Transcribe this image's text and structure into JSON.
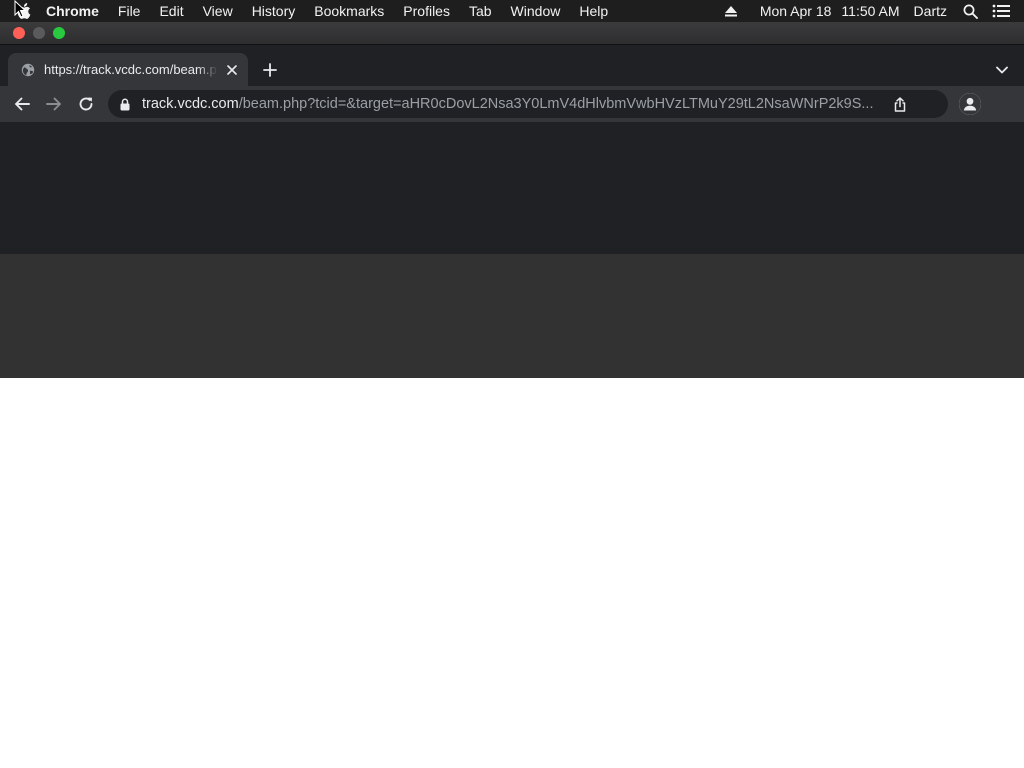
{
  "menubar": {
    "app_name": "Chrome",
    "items": [
      "File",
      "Edit",
      "View",
      "History",
      "Bookmarks",
      "Profiles",
      "Tab",
      "Window",
      "Help"
    ],
    "date": "Mon Apr 18",
    "time": "11:50 AM",
    "user": "Dartz",
    "icons": [
      "apple-icon",
      "eject-icon",
      "spotlight-search-icon",
      "control-center-icon"
    ]
  },
  "window": {
    "controls": [
      "close",
      "minimize",
      "zoom"
    ]
  },
  "tabs": [
    {
      "title": "https://track.vcdc.com/beam.php",
      "active": true,
      "favicon": "globe-icon"
    }
  ],
  "toolbar": {
    "url_host": "track.vcdc.com",
    "url_path": "/beam.php?tcid=&target=aHR0cDovL2Nsa3Y0LmV4dHlvbmVwbHVzLTMuY29tL2NsaWNrP2k9S..."
  },
  "colors": {
    "menubar_bg": "#1e1e1f",
    "tabstrip_bg": "#202124",
    "toolbar_bg": "#35363a",
    "page_top_bg": "#202124",
    "page_mid_bg": "#323232",
    "page_body_bg": "#ffffff"
  }
}
